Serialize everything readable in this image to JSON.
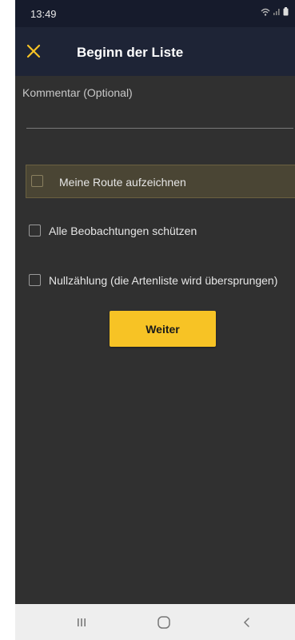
{
  "status_bar": {
    "time": "13:49"
  },
  "app_bar": {
    "close_icon": "close-icon",
    "title": "Beginn der Liste"
  },
  "form": {
    "comment_label": "Kommentar (Optional)",
    "comment_value": "",
    "options": [
      {
        "label": "Meine Route aufzeichnen",
        "checked": false,
        "highlighted": true
      },
      {
        "label": "Alle Beobachtungen schützen",
        "checked": false
      },
      {
        "label": "Nullzählung (die Artenliste wird übersprungen)",
        "checked": false
      }
    ],
    "continue_label": "Weiter"
  },
  "nav_bar": {
    "icons": [
      "recent-apps-icon",
      "home-icon",
      "back-icon"
    ]
  },
  "colors": {
    "accent": "#f7c325",
    "app_bar": "#1e2436",
    "background": "#303030",
    "highlight_row": "#4a4534"
  }
}
